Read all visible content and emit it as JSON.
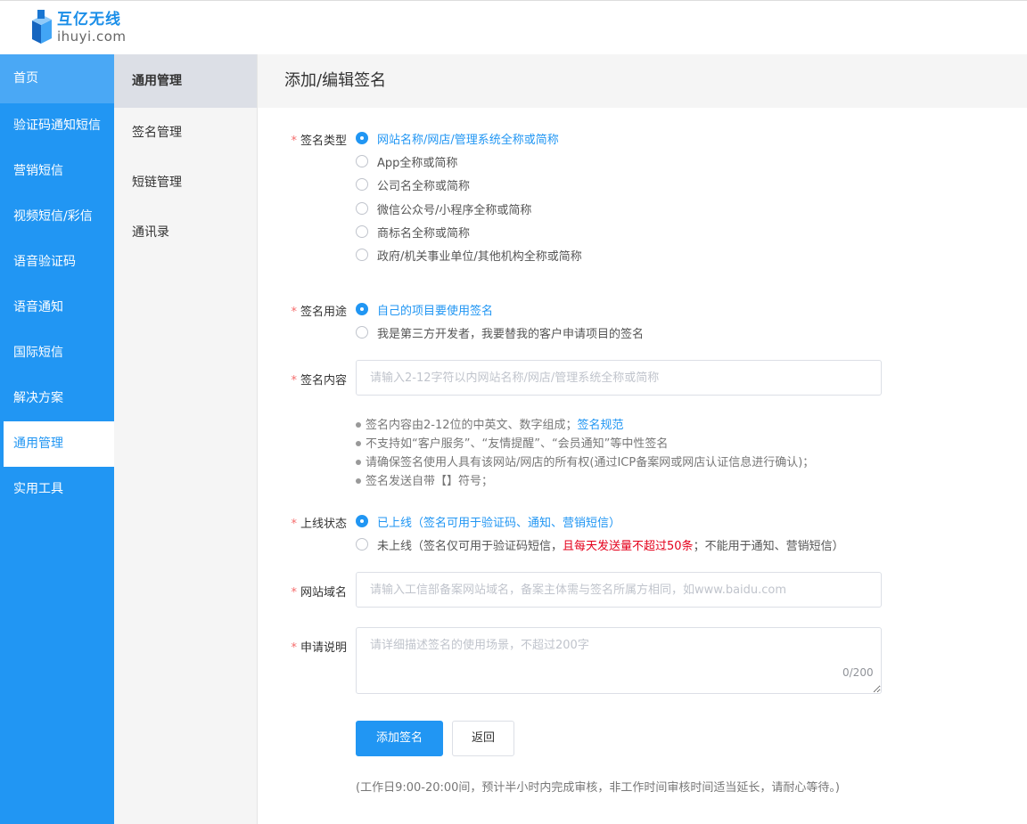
{
  "logo": {
    "cn": "互亿无线",
    "en": "ihuyi.com",
    "colors": {
      "dark": "#1565c0",
      "light": "#42a5f5"
    }
  },
  "nav_primary": [
    {
      "label": "首页",
      "state": "home"
    },
    {
      "label": "验证码通知短信",
      "state": ""
    },
    {
      "label": "营销短信",
      "state": ""
    },
    {
      "label": "视频短信/彩信",
      "state": ""
    },
    {
      "label": "语音验证码",
      "state": ""
    },
    {
      "label": "语音通知",
      "state": ""
    },
    {
      "label": "国际短信",
      "state": ""
    },
    {
      "label": "解决方案",
      "state": ""
    },
    {
      "label": "通用管理",
      "state": "active"
    },
    {
      "label": "实用工具",
      "state": ""
    }
  ],
  "nav_secondary": [
    {
      "label": "通用管理",
      "active": true
    },
    {
      "label": "签名管理",
      "active": false
    },
    {
      "label": "短链管理",
      "active": false
    },
    {
      "label": "通讯录",
      "active": false
    }
  ],
  "page": {
    "title": "添加/编辑签名"
  },
  "form": {
    "required_mark": "*",
    "sign_type": {
      "label": "签名类型",
      "options": [
        {
          "text": "网站名称/网店/管理系统全称或简称",
          "checked": true
        },
        {
          "text": "App全称或简称",
          "checked": false
        },
        {
          "text": "公司名全称或简称",
          "checked": false
        },
        {
          "text": "微信公众号/小程序全称或简称",
          "checked": false
        },
        {
          "text": "商标名全称或简称",
          "checked": false
        },
        {
          "text": "政府/机关事业单位/其他机构全称或简称",
          "checked": false
        }
      ]
    },
    "sign_usage": {
      "label": "签名用途",
      "options": [
        {
          "text": "自己的项目要使用签名",
          "checked": true
        },
        {
          "text": "我是第三方开发者，我要替我的客户申请项目的签名",
          "checked": false
        }
      ]
    },
    "sign_content": {
      "label": "签名内容",
      "value": "",
      "placeholder": "请输入2-12字符以内网站名称/网店/管理系统全称或简称"
    },
    "tips": {
      "line1": "签名内容由2-12位的中英文、数字组成；",
      "line1_link": "签名规范",
      "line2": "不支持如“客户服务”、“友情提醒”、“会员通知”等中性签名",
      "line3": "请确保签名使用人具有该网站/网店的所有权(通过ICP备案网或网店认证信息进行确认)；",
      "line4": "签名发送自带【】符号；"
    },
    "online_status": {
      "label": "上线状态",
      "option1": "已上线（签名可用于验证码、通知、营销短信）",
      "option1_checked": true,
      "option2_part1": "未上线（签名仅可用于验证码短信，",
      "option2_red": "且每天发送量不超过50条",
      "option2_part2": "；不能用于通知、营销短信）",
      "option2_checked": false
    },
    "domain": {
      "label": "网站域名",
      "value": "",
      "placeholder": "请输入工信部备案网站域名，备案主体需与签名所属方相同，如www.baidu.com"
    },
    "description": {
      "label": "申请说明",
      "value": "",
      "placeholder": "请详细描述签名的使用场景，不超过200字",
      "counter": "0/200"
    },
    "buttons": {
      "submit": "添加签名",
      "back": "返回"
    },
    "footnote": "(工作日9:00-20:00间，预计半小时内完成审核，非工作时间审核时间适当延长，请耐心等待。)"
  },
  "colors": {
    "primary": "#2196f3",
    "danger": "#e4001b",
    "required": "#f56c6c"
  }
}
